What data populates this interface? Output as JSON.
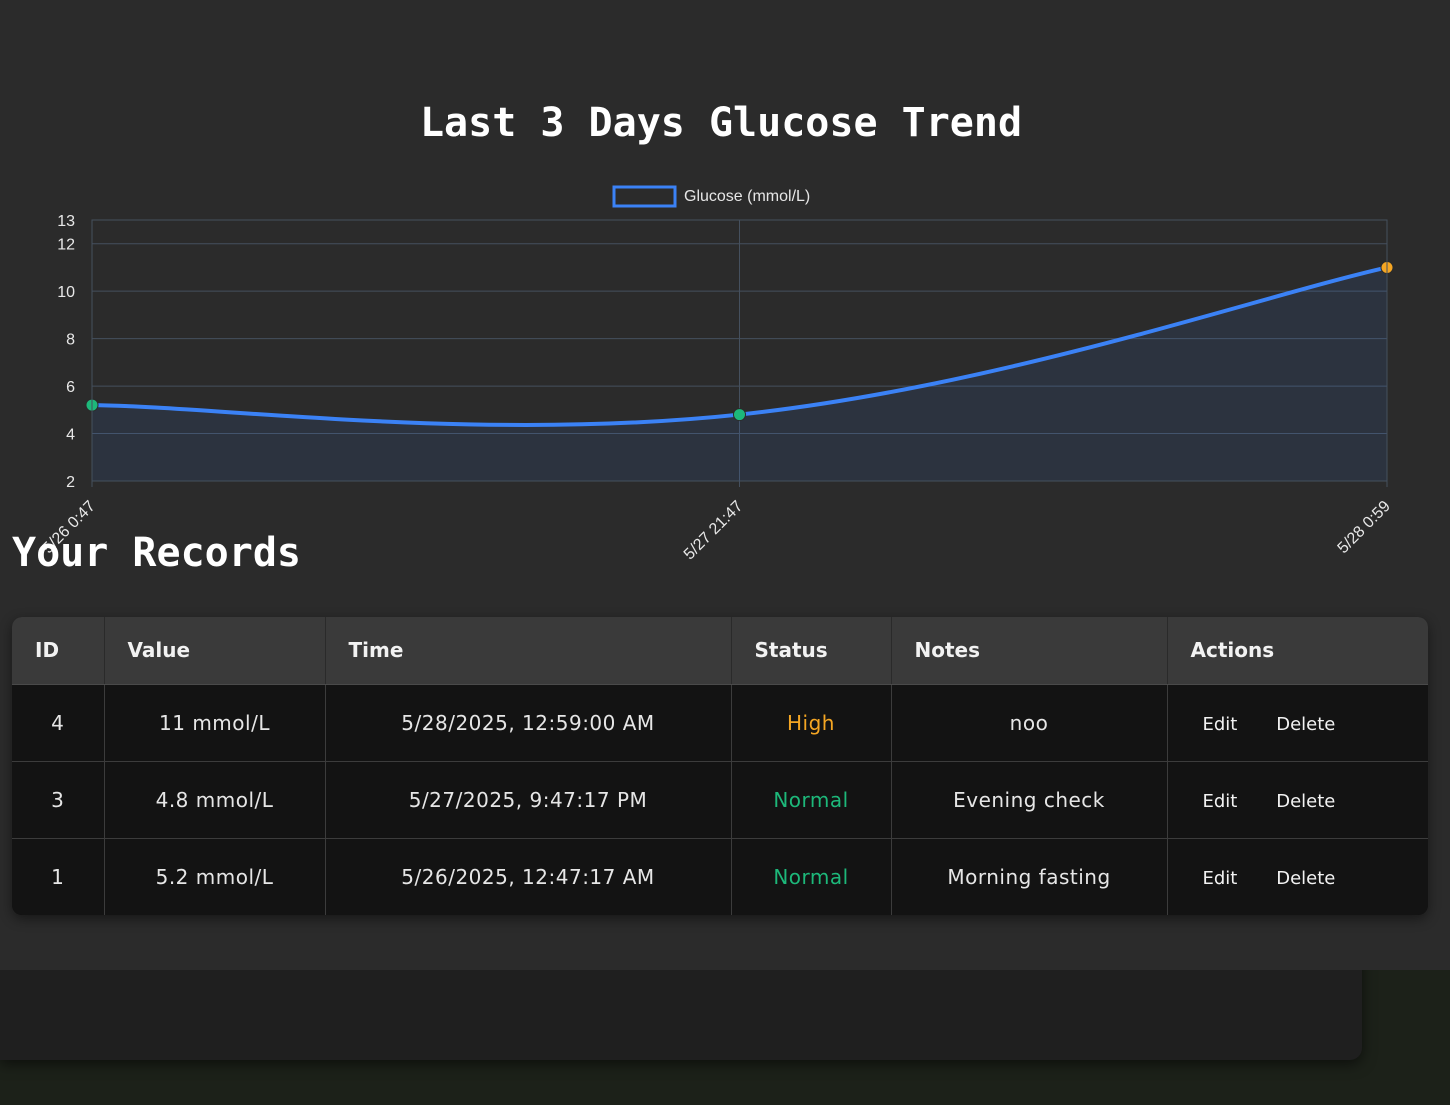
{
  "chart_data": {
    "type": "line",
    "title": "Last 3 Days Glucose Trend",
    "categories": [
      "5/26 0:47",
      "5/27 21:47",
      "5/28 0:59"
    ],
    "series": [
      {
        "name": "Glucose (mmol/L)",
        "values": [
          5.2,
          4.8,
          11
        ],
        "point_colors": [
          "#1db87a",
          "#1db87a",
          "#f5a623"
        ]
      }
    ],
    "ylim": [
      2,
      13
    ],
    "yticks": [
      2,
      4,
      6,
      8,
      10,
      12,
      13
    ],
    "grid": true,
    "fill": true,
    "legend": "top-center",
    "line_color": "#3b82f6"
  },
  "records": {
    "heading": "Your Records",
    "columns": [
      "ID",
      "Value",
      "Time",
      "Status",
      "Notes",
      "Actions"
    ],
    "rows": [
      {
        "id": "4",
        "value": "11 mmol/L",
        "time": "5/28/2025, 12:59:00 AM",
        "status": "High",
        "notes": "noo",
        "edit": "Edit",
        "delete": "Delete"
      },
      {
        "id": "3",
        "value": "4.8 mmol/L",
        "time": "5/27/2025, 9:47:17 PM",
        "status": "Normal",
        "notes": "Evening check",
        "edit": "Edit",
        "delete": "Delete"
      },
      {
        "id": "1",
        "value": "5.2 mmol/L",
        "time": "5/26/2025, 12:47:17 AM",
        "status": "Normal",
        "notes": "Morning fasting",
        "edit": "Edit",
        "delete": "Delete"
      }
    ]
  },
  "colors": {
    "high": "#f5a623",
    "normal": "#1db87a"
  }
}
